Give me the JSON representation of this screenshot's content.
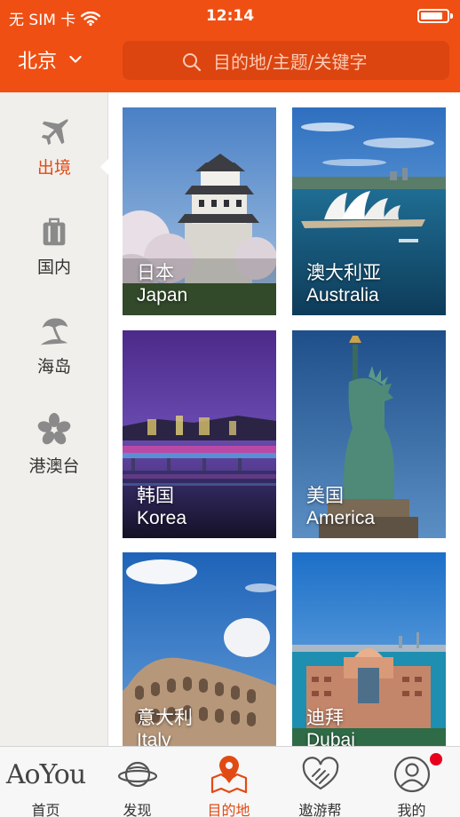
{
  "status_bar": {
    "carrier": "无 SIM 卡",
    "time": "12:14",
    "battery_level": 0.85
  },
  "header": {
    "city": "北京",
    "search_placeholder": "目的地/主题/关键字"
  },
  "sidebar": {
    "items": [
      {
        "label": "出境",
        "icon": "airplane-icon",
        "active": true
      },
      {
        "label": "国内",
        "icon": "luggage-icon",
        "active": false
      },
      {
        "label": "海岛",
        "icon": "island-icon",
        "active": false
      },
      {
        "label": "港澳台",
        "icon": "bauhinia-flower-icon",
        "active": false
      }
    ]
  },
  "destinations": [
    {
      "cn": "日本",
      "en": "Japan",
      "scene": "japan-castle"
    },
    {
      "cn": "澳大利亚",
      "en": "Australia",
      "scene": "sydney-opera-house"
    },
    {
      "cn": "韩国",
      "en": "Korea",
      "scene": "seoul-night-bridge"
    },
    {
      "cn": "美国",
      "en": "America",
      "scene": "statue-of-liberty"
    },
    {
      "cn": "意大利",
      "en": "Italy",
      "scene": "colosseum"
    },
    {
      "cn": "迪拜",
      "en": "Dubai",
      "scene": "dubai-atlantis"
    }
  ],
  "tabbar": {
    "brand": "AoYou",
    "tabs": [
      {
        "label": "首页",
        "icon": "aoyou-logo",
        "active": false
      },
      {
        "label": "发现",
        "icon": "planet-icon",
        "active": false
      },
      {
        "label": "目的地",
        "icon": "map-pin-icon",
        "active": true
      },
      {
        "label": "遨游帮",
        "icon": "heart-hands-icon",
        "active": false
      },
      {
        "label": "我的",
        "icon": "user-icon",
        "active": false,
        "badge": true
      }
    ]
  },
  "colors": {
    "accent": "#ef4f13",
    "active_text": "#e24a14",
    "sidebar_bg": "#f1efeb",
    "badge": "#e8001c"
  }
}
